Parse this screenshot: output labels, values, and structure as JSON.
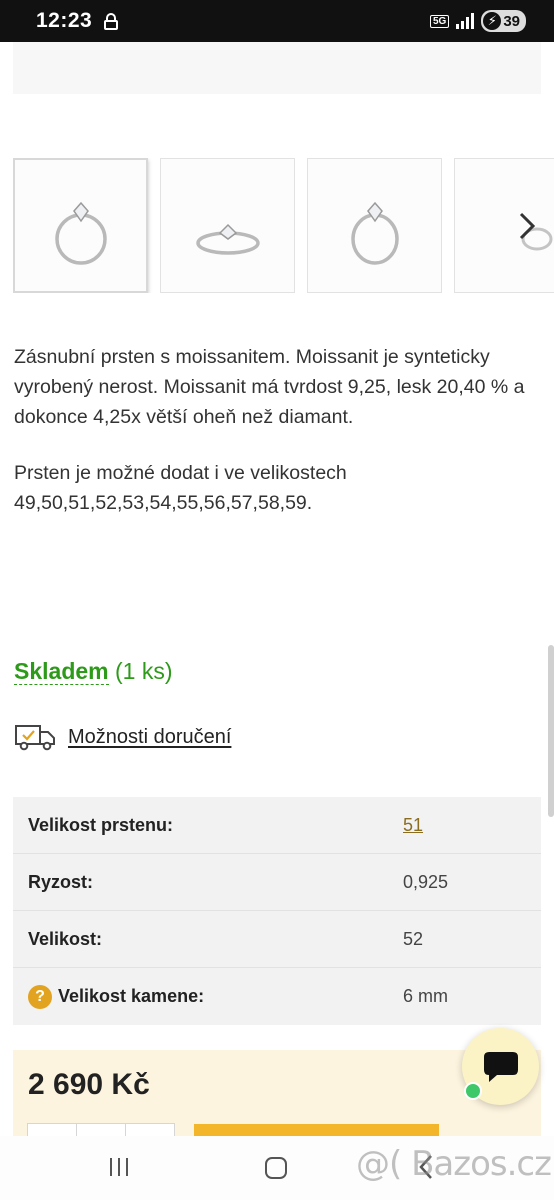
{
  "status_bar": {
    "time": "12:23",
    "network": "5G",
    "battery": "39"
  },
  "gallery": {
    "thumbnails": [
      "ring-thumbnail-1",
      "ring-thumbnail-2",
      "ring-thumbnail-3",
      "ring-thumbnail-4"
    ],
    "next_icon": "chevron-right-icon"
  },
  "description": {
    "paragraph1": "Zásnubní prsten s moissanitem. Moissanit je synteticky vyrobený nerost. Moissanit má tvrdost 9,25, lesk 20,40 % a dokonce 4,25x větší oheň než diamant.",
    "paragraph2": "Prsten je možné dodat i ve velikostech 49,50,51,52,53,54,55,56,57,58,59."
  },
  "stock": {
    "label": "Skladem",
    "count": "(1 ks)"
  },
  "delivery": {
    "label": "Možnosti doručení",
    "icon": "truck-icon"
  },
  "params": [
    {
      "label": "Velikost prstenu:",
      "value": "51",
      "link": true,
      "help": false
    },
    {
      "label": "Ryzost:",
      "value": "0,925",
      "link": false,
      "help": false
    },
    {
      "label": "Velikost:",
      "value": "52",
      "link": false,
      "help": false
    },
    {
      "label": "Velikost kamene:",
      "value": "6 mm",
      "link": false,
      "help": true,
      "help_symbol": "?"
    }
  ],
  "price": {
    "value": "2 690 Kč"
  },
  "watermark": "@( Bazos.cz",
  "colors": {
    "stock_green": "#2e9a1a",
    "accent_gold": "#f3b62a",
    "link_brown": "#8a6d1f",
    "price_bg": "#fdf4df"
  }
}
